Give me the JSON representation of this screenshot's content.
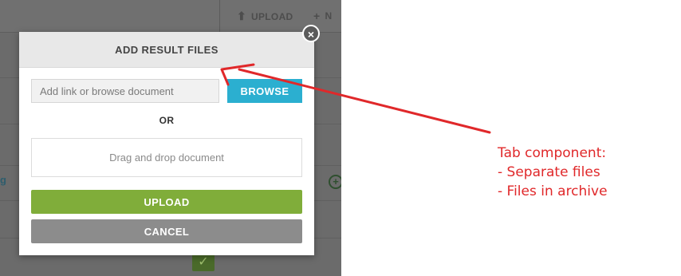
{
  "background_app": {
    "toolbar": {
      "upload_label": "UPLOAD",
      "new_label_fragment": "N"
    },
    "link_fragment": "g"
  },
  "modal": {
    "title": "ADD RESULT FILES",
    "close_glyph": "×",
    "link_input": {
      "placeholder": "Add link or browse document",
      "value": ""
    },
    "browse_label": "BROWSE",
    "or_label": "OR",
    "dropzone_text": "Drag and drop document",
    "upload_label": "UPLOAD",
    "cancel_label": "CANCEL",
    "colors": {
      "browse": "#2bafd0",
      "upload": "#80ad3a",
      "cancel": "#8c8c8c",
      "header": "#e8e8e8"
    }
  },
  "annotation": {
    "color": "#e0282a",
    "lines": [
      "Tab component:",
      "- Separate files",
      "- Files in archive"
    ]
  }
}
